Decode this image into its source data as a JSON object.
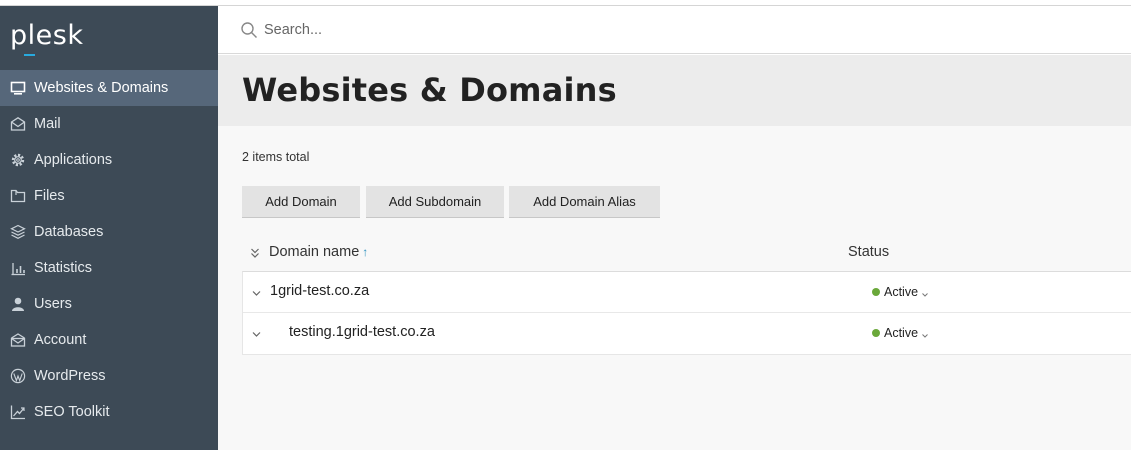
{
  "app": {
    "logo_text": "plesk",
    "accent_color": "#28aade"
  },
  "sidebar": {
    "items": [
      {
        "label": "Websites & Domains",
        "icon": "monitor-icon",
        "active": true
      },
      {
        "label": "Mail",
        "icon": "envelope-icon"
      },
      {
        "label": "Applications",
        "icon": "gear-icon"
      },
      {
        "label": "Files",
        "icon": "folder-icon"
      },
      {
        "label": "Databases",
        "icon": "layers-icon"
      },
      {
        "label": "Statistics",
        "icon": "bar-chart-icon"
      },
      {
        "label": "Users",
        "icon": "user-icon"
      },
      {
        "label": "Account",
        "icon": "account-icon"
      },
      {
        "label": "WordPress",
        "icon": "wordpress-icon"
      },
      {
        "label": "SEO Toolkit",
        "icon": "seo-chart-icon"
      }
    ]
  },
  "search": {
    "placeholder": "Search..."
  },
  "page": {
    "title": "Websites & Domains",
    "items_total": "2 items total"
  },
  "toolbar": {
    "add_domain": "Add Domain",
    "add_subdomain": "Add Subdomain",
    "add_domain_alias": "Add Domain Alias"
  },
  "table": {
    "columns": {
      "domain_name": "Domain name",
      "sort_indicator": "↑",
      "status": "Status"
    },
    "rows": [
      {
        "domain": "1grid-test.co.za",
        "status": "Active",
        "status_color": "#6aa83a"
      },
      {
        "domain": "testing.1grid-test.co.za",
        "status": "Active",
        "status_color": "#6aa83a"
      }
    ]
  }
}
